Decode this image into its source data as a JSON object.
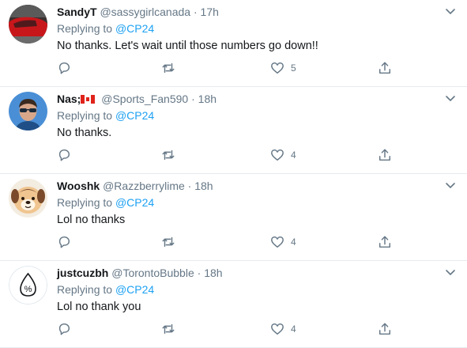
{
  "tweets": [
    {
      "name": "SandyT",
      "handle": "@sassygirlcanada",
      "separator": "·",
      "time": "17h",
      "replying_label": "Replying to",
      "replying_to": "@CP24",
      "text": "No thanks. Let's wait until those numbers go down!!",
      "likes": "5",
      "avatar_icon": "red-car-avatar"
    },
    {
      "name": "Nas;",
      "flag_icon": "canada-flag-icon",
      "handle": "@Sports_Fan590",
      "separator": "·",
      "time": "18h",
      "replying_label": "Replying to",
      "replying_to": "@CP24",
      "text": "No thanks.",
      "likes": "4",
      "avatar_icon": "man-sunglasses-avatar"
    },
    {
      "name": "Wooshk",
      "handle": "@Razzberrylime",
      "separator": "·",
      "time": "18h",
      "replying_label": "Replying to",
      "replying_to": "@CP24",
      "text": "Lol no thanks",
      "likes": "4",
      "avatar_icon": "dog-character-avatar"
    },
    {
      "name": "justcuzbh",
      "handle": "@TorontoBubble",
      "separator": "·",
      "time": "18h",
      "replying_label": "Replying to",
      "replying_to": "@CP24",
      "text": "Lol no thank you",
      "likes": "4",
      "avatar_icon": "percent-drop-avatar"
    }
  ],
  "colors": {
    "link": "#1da1f2",
    "muted": "#657786",
    "text": "#14171a",
    "divider": "#e6ecf0"
  }
}
